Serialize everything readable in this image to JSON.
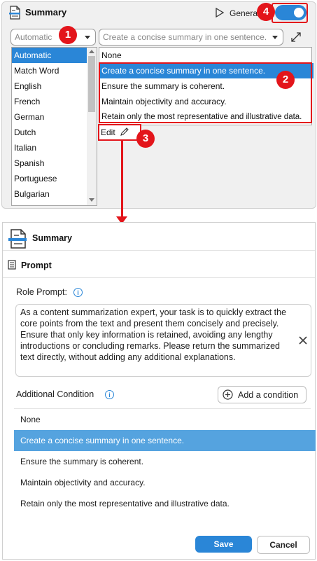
{
  "top": {
    "title": "Summary",
    "generate_label": "Generate",
    "toggle_on": true,
    "language_selected": "Automatic",
    "condition_selected": "Create a concise summary in one sentence.",
    "language_options": [
      "Automatic",
      "Match Word",
      "English",
      "French",
      "German",
      "Dutch",
      "Italian",
      "Spanish",
      "Portuguese",
      "Bulgarian"
    ],
    "condition_options": [
      "None",
      "Create a concise summary in one sentence.",
      "Ensure the summary is coherent.",
      "Maintain objectivity and accuracy.",
      "Retain only the most representative and illustrative data."
    ],
    "edit_label": "Edit"
  },
  "callouts": [
    "1",
    "2",
    "3",
    "4"
  ],
  "dialog": {
    "title": "Summary",
    "section": "Prompt",
    "role_prompt_label": "Role Prompt:",
    "role_prompt_text": "As a content summarization expert, your task is to quickly extract the core points from the text and present them concisely and precisely. Ensure that only key information is retained, avoiding any lengthy introductions or concluding remarks. Please return the summarized text directly, without adding any additional explanations.",
    "additional_condition_label": "Additional Condition",
    "add_condition_button": "Add a condition",
    "options": [
      "None",
      "Create a concise summary in one sentence.",
      "Ensure the summary is coherent.",
      "Maintain objectivity and accuracy.",
      "Retain only the most representative and illustrative data."
    ],
    "selected_index": 1,
    "save_label": "Save",
    "cancel_label": "Cancel"
  },
  "colors": {
    "accent": "#2a86d7",
    "callout": "#e3151b",
    "selected_row": "#55a3df"
  }
}
